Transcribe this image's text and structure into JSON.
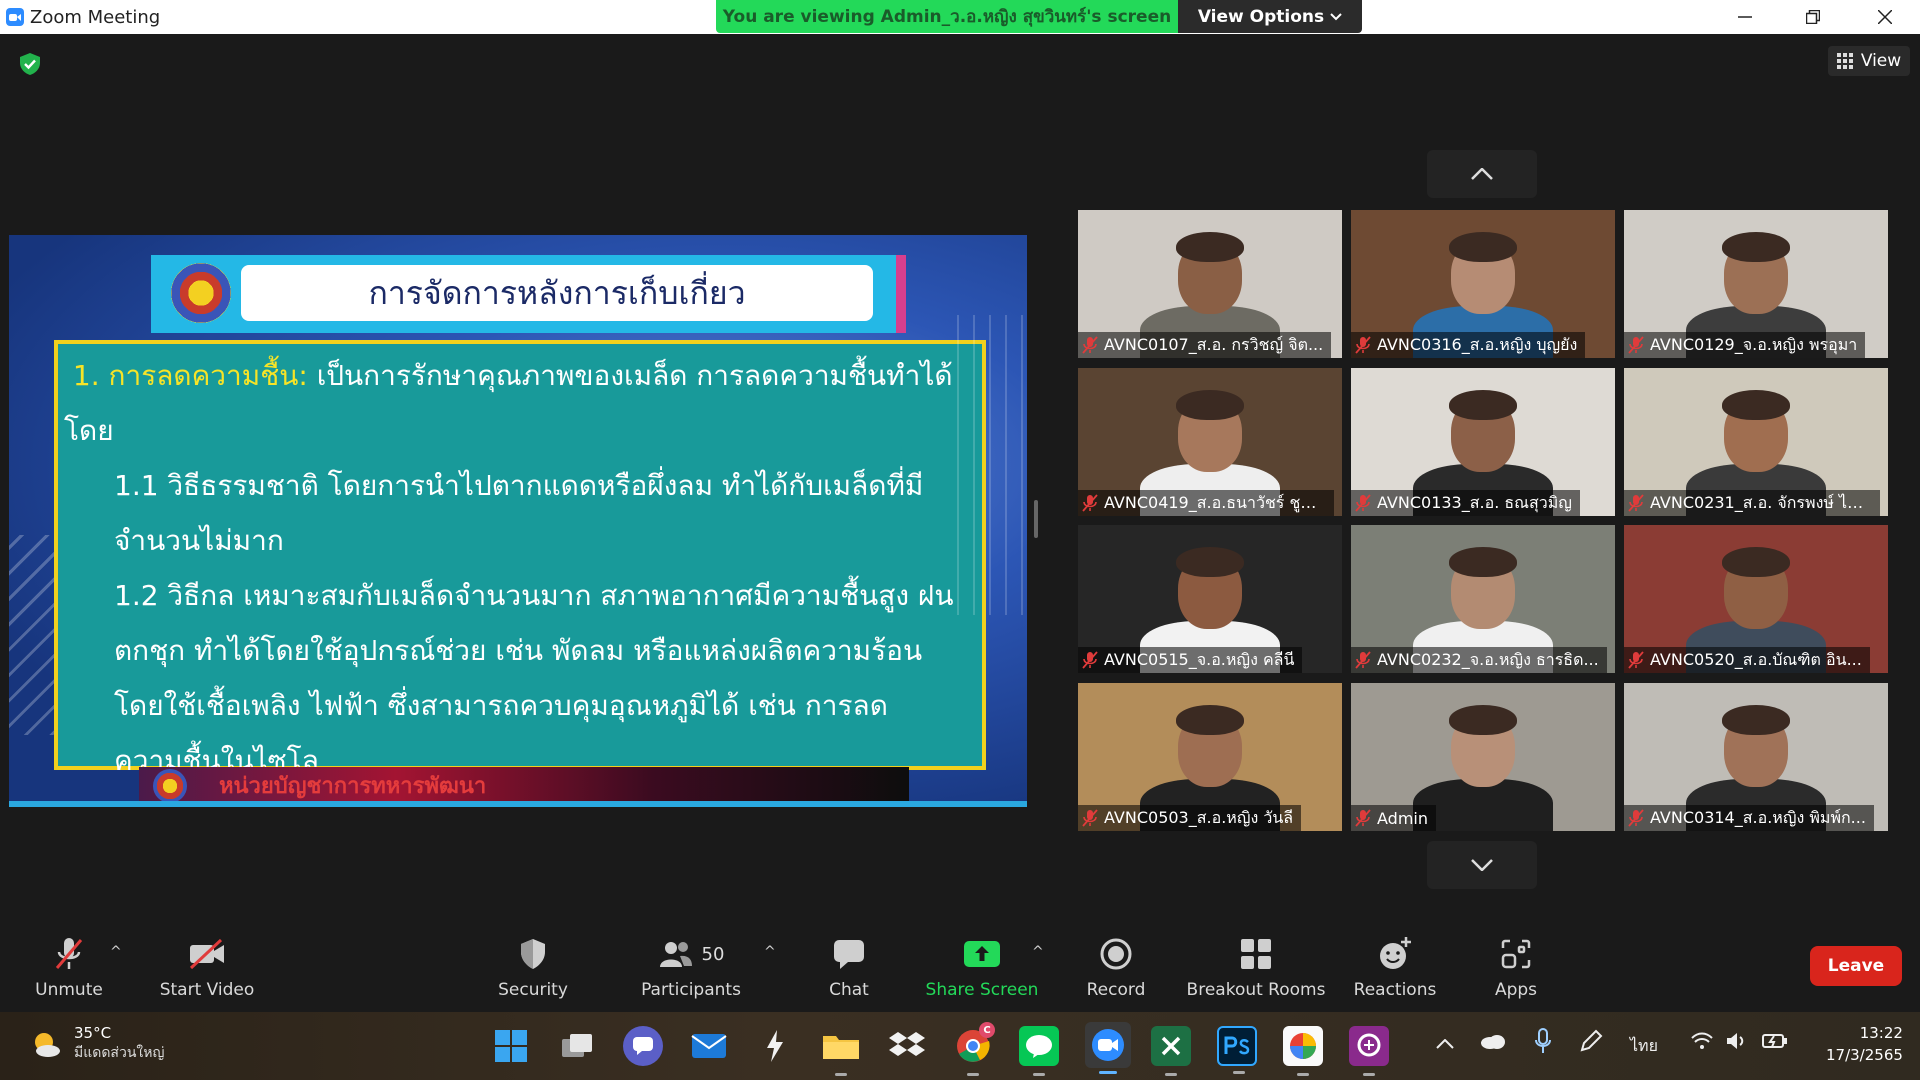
{
  "window": {
    "title": "Zoom Meeting",
    "share_banner": "You are viewing Admin_ว.อ.หญิง สุขวินทร์'s screen",
    "view_options": "View Options",
    "view_button": "View"
  },
  "slide": {
    "title": "การจัดการหลังการเก็บเกี่ยว",
    "heading_highlight": "1. การลดความชื้น:",
    "heading_rest": " เป็นการรักษาคุณภาพของเมล็ด การลดความชื้นทำได้โดย",
    "item1": "1.1 วิธีธรรมชาติ โดยการนำไปตากแดดหรือผึ่งลม ทำได้กับเมล็ดที่มีจำนวนไม่มาก",
    "item2": "1.2 วิธีกล เหมาะสมกับเมล็ดจำนวนมาก สภาพอากาศมีความชื้นสูง ฝนตกชุก ทำได้โดยใช้อุปกรณ์ช่วย เช่น พัดลม หรือแหล่งผลิตความร้อน โดยใช้เชื้อเพลิง ไฟฟ้า ซึ่งสามารถควบคุมอุณหภูมิได้ เช่น การลดความชื้นในไซโล",
    "footer": "หน่วยบัญชาการทหารพัฒนา"
  },
  "participants": [
    {
      "name": "AVNC0107_ส.อ. กรวิชญ์ จิต...",
      "bg": "#cfcac4",
      "skin": "#8a5f45",
      "shirt": "#6d6b63"
    },
    {
      "name": "AVNC0316_ส.อ.หญิง บุญยัง",
      "bg": "#6e4a33",
      "skin": "#b68c74",
      "shirt": "#2c6ea8"
    },
    {
      "name": "AVNC0129_จ.อ.หญิง พรอุมา",
      "bg": "#d0ccc6",
      "skin": "#9c7055",
      "shirt": "#3d3d3d"
    },
    {
      "name": "AVNC0419_ส.อ.ธนาวัชร์ ชูช...",
      "bg": "#5a4432",
      "skin": "#a7785c",
      "shirt": "#eeeeee"
    },
    {
      "name": "AVNC0133_ส.อ. ธณสุวมิญ",
      "bg": "#dedad4",
      "skin": "#8c6048",
      "shirt": "#2a2a2a"
    },
    {
      "name": "AVNC0231_ส.อ. จักรพงษ์ ไข...",
      "bg": "#cfc9bb",
      "skin": "#a06e50",
      "shirt": "#3a3a3a"
    },
    {
      "name": "AVNC0515_จ.อ.หญิง คลีนี",
      "bg": "#262626",
      "skin": "#8c5a40",
      "shirt": "#f2f2f2"
    },
    {
      "name": "AVNC0232_จ.อ.หญิง ธารธิด...",
      "bg": "#7c7f76",
      "skin": "#b38b72",
      "shirt": "#f0f0f0"
    },
    {
      "name": "AVNC0520_ส.อ.บัณฑิต อิน...",
      "bg": "#8b3c34",
      "skin": "#8f5f44",
      "shirt": "#3f4c5c"
    },
    {
      "name": "AVNC0503_ส.อ.หญิง วันลี",
      "bg": "#b38d5a",
      "skin": "#9e6e52",
      "shirt": "#222222"
    },
    {
      "name": "Admin",
      "bg": "#9e9a92",
      "skin": "#b89078",
      "shirt": "#1f1f1f"
    },
    {
      "name": "AVNC0314_ส.อ.หญิง พิมพ์ก...",
      "bg": "#bfbcb6",
      "skin": "#a07258",
      "shirt": "#2b2b2b"
    }
  ],
  "toolbar": {
    "unmute": "Unmute",
    "start_video": "Start Video",
    "security": "Security",
    "participants": "Participants",
    "participants_count": "50",
    "chat": "Chat",
    "share_screen": "Share Screen",
    "record": "Record",
    "breakout_rooms": "Breakout Rooms",
    "reactions": "Reactions",
    "apps": "Apps",
    "leave": "Leave"
  },
  "taskbar": {
    "temperature": "35°C",
    "weather_desc": "มีแดดส่วนใหญ่",
    "language": "ไทย",
    "time": "13:22",
    "date": "17/3/2565",
    "chrome_badge": "C"
  },
  "colors": {
    "share_green": "#23d959",
    "leave_red": "#d9251c",
    "slide_teal": "#189a9a",
    "slide_border": "#f1d11d"
  }
}
